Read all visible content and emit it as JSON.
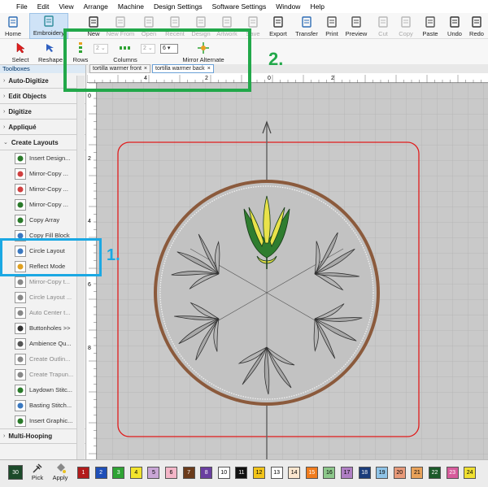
{
  "menu": [
    "File",
    "Edit",
    "View",
    "Arrange",
    "Machine",
    "Design Settings",
    "Software Settings",
    "Window",
    "Help"
  ],
  "toolbar": {
    "buttons": [
      {
        "label": "Home",
        "icon": "home-icon"
      },
      {
        "label": "Embroidery",
        "icon": "embroidery-icon"
      },
      {
        "label": "New",
        "icon": "new-file-icon"
      },
      {
        "label": "New From",
        "icon": "new-from-icon"
      },
      {
        "label": "Open",
        "icon": "open-icon"
      },
      {
        "label": "Recent",
        "icon": "recent-icon"
      },
      {
        "label": "Design",
        "icon": "design-icon"
      },
      {
        "label": "Artwork",
        "icon": "artwork-icon"
      },
      {
        "label": "Save",
        "icon": "save-icon"
      },
      {
        "label": "Export",
        "icon": "export-icon"
      },
      {
        "label": "Transfer",
        "icon": "transfer-icon"
      },
      {
        "label": "Print",
        "icon": "print-icon"
      },
      {
        "label": "Preview",
        "icon": "preview-icon"
      },
      {
        "label": "Cut",
        "icon": "cut-icon"
      },
      {
        "label": "Copy",
        "icon": "copy-icon"
      },
      {
        "label": "Paste",
        "icon": "paste-icon"
      },
      {
        "label": "Undo",
        "icon": "undo-icon"
      },
      {
        "label": "Redo",
        "icon": "redo-icon"
      }
    ]
  },
  "toolbar2": {
    "select": "Select",
    "reshape": "Reshape",
    "rows": "Rows",
    "columns": "Columns",
    "rows_value": "2",
    "columns_value1": "2",
    "columns_value2": "6",
    "mirror_alternate": "Mirror Alternate"
  },
  "tabs": [
    {
      "label": "tortilla warmer front",
      "close": "×"
    },
    {
      "label": "tortilla warmer back",
      "close": "×"
    }
  ],
  "toolboxes": {
    "title": "Toolboxes",
    "sections_top": [
      "Auto-Digitize",
      "Edit Objects",
      "Digitize",
      "Appliqué",
      "Create Layouts"
    ],
    "items": [
      {
        "label": "Insert Design..."
      },
      {
        "label": "Mirror-Copy ..."
      },
      {
        "label": "Mirror-Copy ..."
      },
      {
        "label": "Mirror-Copy ..."
      },
      {
        "label": "Copy Array"
      },
      {
        "label": "Copy Fill Block"
      },
      {
        "label": "Circle Layout"
      },
      {
        "label": "Reflect Mode"
      },
      {
        "label": "Mirror-Copy t..."
      },
      {
        "label": "Circle Layout ..."
      },
      {
        "label": "Auto Center t..."
      },
      {
        "label": "Buttonholes >>"
      },
      {
        "label": "Ambience Qu..."
      },
      {
        "label": "Create Outlin..."
      },
      {
        "label": "Create Trapun..."
      },
      {
        "label": "Laydown Stitc..."
      },
      {
        "label": "Basting Stitch..."
      },
      {
        "label": "Insert Graphic..."
      }
    ],
    "sections_bottom": [
      "Multi-Hooping"
    ]
  },
  "ruler": {
    "top_labels": [
      "4",
      "2",
      "0",
      "2"
    ],
    "left_labels": [
      "0",
      "2",
      "4",
      "6",
      "8"
    ]
  },
  "palette": {
    "current": "30",
    "pick": "Pick",
    "apply": "Apply",
    "swatches": [
      {
        "n": "1",
        "c": "#b21b1b"
      },
      {
        "n": "2",
        "c": "#1f4fb8"
      },
      {
        "n": "3",
        "c": "#2fa334"
      },
      {
        "n": "4",
        "c": "#f2e42c"
      },
      {
        "n": "5",
        "c": "#c9a6d6"
      },
      {
        "n": "6",
        "c": "#f4b6c8"
      },
      {
        "n": "7",
        "c": "#6b3b1b"
      },
      {
        "n": "8",
        "c": "#6a3fa0"
      },
      {
        "n": "10",
        "c": "#ffffff"
      },
      {
        "n": "11",
        "c": "#111111"
      },
      {
        "n": "12",
        "c": "#f2c41a"
      },
      {
        "n": "13",
        "c": "#ffffff"
      },
      {
        "n": "14",
        "c": "#fbe6cf"
      },
      {
        "n": "15",
        "c": "#f07c1e"
      },
      {
        "n": "16",
        "c": "#8cc78a"
      },
      {
        "n": "17",
        "c": "#b07fc4"
      },
      {
        "n": "18",
        "c": "#1b3c7a"
      },
      {
        "n": "19",
        "c": "#8fc4e8"
      },
      {
        "n": "20",
        "c": "#e89a7a"
      },
      {
        "n": "21",
        "c": "#e8a25a"
      },
      {
        "n": "22",
        "c": "#1c5a2a"
      },
      {
        "n": "23",
        "c": "#d65b9b"
      },
      {
        "n": "24",
        "c": "#f0e030"
      }
    ]
  },
  "annotations": {
    "one": "1.",
    "two": "2."
  },
  "colors": {
    "accent": "#1ba8e3",
    "green": "#22a84a",
    "hoop": "#8b5a3c",
    "boundary": "#e01b1b"
  }
}
